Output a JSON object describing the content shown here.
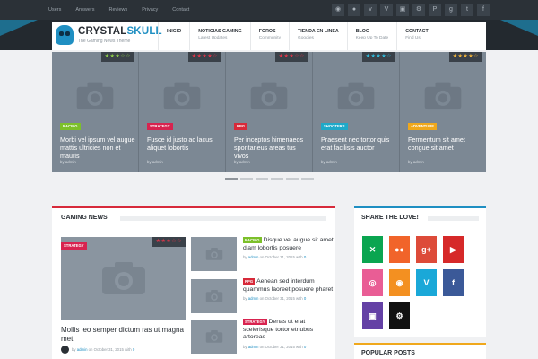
{
  "topbar": {
    "links": [
      "Users",
      "Answers",
      "Reviews",
      "Privacy",
      "Contact"
    ],
    "social_icons": [
      "rss-icon",
      "apple-icon",
      "vine-icon",
      "vimeo-icon",
      "twitch-icon",
      "steam-icon",
      "pinterest-icon",
      "googleplus-icon",
      "twitter-icon",
      "facebook-icon"
    ]
  },
  "brand": {
    "name_part1": "CRYSTAL",
    "name_part2": "SKULL",
    "tagline": "The Gaming News Theme",
    "accent": "#1f8fc2"
  },
  "nav": [
    {
      "label": "INICIO",
      "sub": ""
    },
    {
      "label": "NOTICIAS GAMING",
      "sub": "Latest Updates"
    },
    {
      "label": "FOROS",
      "sub": "Community"
    },
    {
      "label": "TIENDA EN LINEA",
      "sub": "Goodies"
    },
    {
      "label": "BLOG",
      "sub": "Keep Up To Date"
    },
    {
      "label": "CONTACT",
      "sub": "Find Us!"
    }
  ],
  "slides": [
    {
      "category": "RACING",
      "cat_color": "#7cc02a",
      "stars": "★★★☆☆",
      "star_color": "#8fd04a",
      "title": "Morbi vel ipsum vel augue mattis ultricies non et mauris",
      "author": "by admin"
    },
    {
      "category": "STRATEGY",
      "cat_color": "#d8234f",
      "stars": "★★★★☆",
      "star_color": "#e4354a",
      "title": "Fusce id justo ac lacus aliquet lobortis",
      "author": "by admin"
    },
    {
      "category": "RPG",
      "cat_color": "#d72a3a",
      "stars": "★★★☆☆",
      "star_color": "#e4354a",
      "title": "Per inceptos himenaeos spontaneus areas tus vivos",
      "author": "by admin"
    },
    {
      "category": "SHOOTERS",
      "cat_color": "#1fa9c9",
      "stars": "★★★★☆",
      "star_color": "#2fbfe0",
      "title": "Praesent nec tortor quis erat facilisis auctor",
      "author": "by admin"
    },
    {
      "category": "ADVENTURE",
      "cat_color": "#f0a81c",
      "stars": "★★★★☆",
      "star_color": "#f2b53a",
      "title": "Fermentum sit amet congue sit amet",
      "author": "by admin"
    }
  ],
  "news": {
    "heading": "GAMING NEWS",
    "featured": {
      "category": "STRATEGY",
      "cat_color": "#d8234f",
      "stars": "★★★☆☆",
      "title": "Mollis leo semper dictum ras ut magna met",
      "meta_by": "by",
      "meta_author": "admin",
      "meta_date": "on October 31, 2015 with",
      "meta_comments": "0"
    },
    "side": [
      {
        "category": "RACING",
        "cat_color": "#7cc02a",
        "title": "Disque vel augue sit amet diam lobortis posuere",
        "meta_author": "admin",
        "meta_date": "on October 31, 2015 with",
        "meta_comments": "0"
      },
      {
        "category": "RPG",
        "cat_color": "#d72a3a",
        "title": "Aenean sed interdum quammus laoreet posuere pharet",
        "meta_author": "admin",
        "meta_date": "on October 31, 2015 with",
        "meta_comments": "0"
      },
      {
        "category": "STRATEGY",
        "cat_color": "#d8234f",
        "title": "Denas ut erat scelerisque tortor etnubus artoreas",
        "meta_author": "admin",
        "meta_date": "on October 31, 2015 with",
        "meta_comments": "0"
      }
    ]
  },
  "share": {
    "heading": "SHARE THE LOVE!",
    "buttons": [
      {
        "icon": "deviantart-icon",
        "glyph": "✕",
        "color": "#0aa550"
      },
      {
        "icon": "flickr-icon",
        "glyph": "●●",
        "color": "#f1642a"
      },
      {
        "icon": "googleplus-icon",
        "glyph": "g+",
        "color": "#dd4b39"
      },
      {
        "icon": "youtube-icon",
        "glyph": "▶",
        "color": "#d62929"
      },
      {
        "icon": "dribbble-icon",
        "glyph": "◎",
        "color": "#e95d95"
      },
      {
        "icon": "rss-icon",
        "glyph": "◉",
        "color": "#f39021"
      },
      {
        "icon": "vimeo-icon",
        "glyph": "V",
        "color": "#1aa8d8"
      },
      {
        "icon": "facebook-icon",
        "glyph": "f",
        "color": "#3b5998"
      },
      {
        "icon": "twitch-icon",
        "glyph": "▣",
        "color": "#6441a5"
      },
      {
        "icon": "steam-icon",
        "glyph": "⚙",
        "color": "#111111"
      }
    ]
  },
  "popular": {
    "heading": "POPULAR POSTS"
  }
}
